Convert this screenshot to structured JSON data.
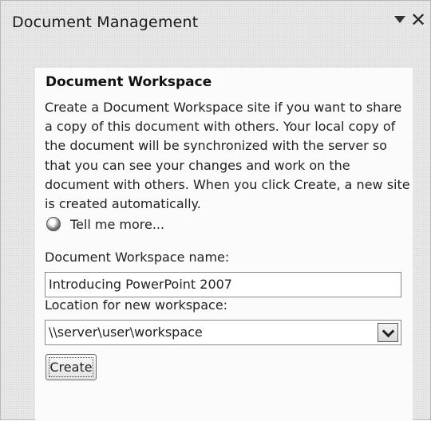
{
  "window": {
    "title": "Document Management",
    "menu_icon": "triangle-down-icon",
    "close_glyph": "✕"
  },
  "panel": {
    "section_title": "Document Workspace",
    "description": "Create a Document Workspace site if you want to share a copy of this document with others. Your local copy of the document will be synchronized with the server so that you can see your changes and work on the document with others. When you click Create, a new site is created automatically.",
    "help_icon": "help-icon",
    "help_link": "Tell me more..."
  },
  "form": {
    "name_label": "Document Workspace name:",
    "name_value": "Introducing PowerPoint 2007",
    "location_label": "Location for new workspace:",
    "location_value": "\\\\server\\user\\workspace",
    "create_label": "Create"
  }
}
